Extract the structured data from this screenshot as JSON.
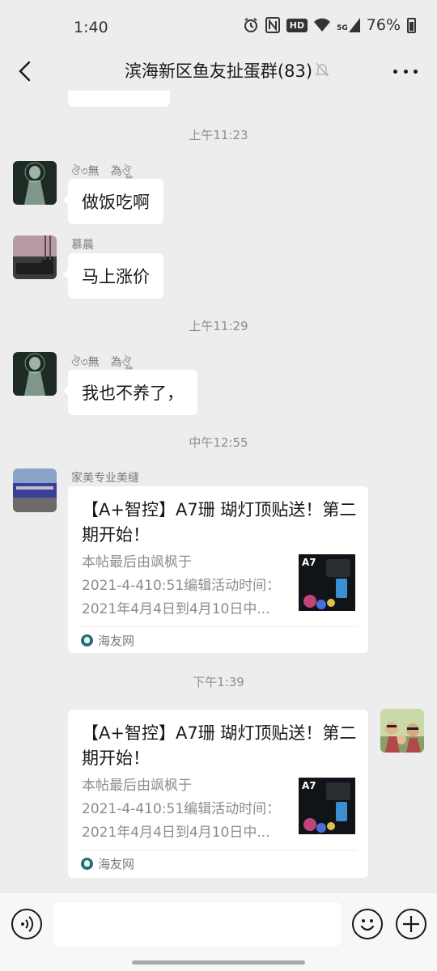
{
  "status_bar": {
    "time": "1:40",
    "hd": "HD",
    "network": "5G",
    "battery": "76%"
  },
  "header": {
    "title": "滨海新区鱼友扯蛋群(83)"
  },
  "messages": {
    "ts1": "上午11:23",
    "m1": {
      "sender": "ঔ৩無　為ঔৣ",
      "text": "做饭吃啊"
    },
    "m2": {
      "sender": "慕晨",
      "text": "马上涨价"
    },
    "ts2": "上午11:29",
    "m3": {
      "sender": "ঔ৩無　為ঔৣ",
      "text": "我也不养了，"
    },
    "ts3": "中午12:55",
    "m4": {
      "sender": "家美专业美缝",
      "card_title": "【A+智控】A7珊 瑚灯顶贴送！第二期开始！",
      "card_desc_line1": "本帖最后由飒枫于",
      "card_desc_line2": "2021-4-410:51编辑活动时间：",
      "card_desc_line3": "2021年4月4日到4月10日中...",
      "thumb_label": "A7",
      "source": "海友网"
    },
    "ts4": "下午1:39",
    "m5": {
      "card_title": "【A+智控】A7珊 瑚灯顶贴送！第二期开始！",
      "card_desc_line1": "本帖最后由飒枫于",
      "card_desc_line2": "2021-4-410:51编辑活动时间：",
      "card_desc_line3": "2021年4月4日到4月10日中...",
      "thumb_label": "A7",
      "source": "海友网"
    }
  },
  "colors": {
    "background": "#ededed",
    "bubble": "#ffffff",
    "timestamp": "#8e8e8e"
  }
}
